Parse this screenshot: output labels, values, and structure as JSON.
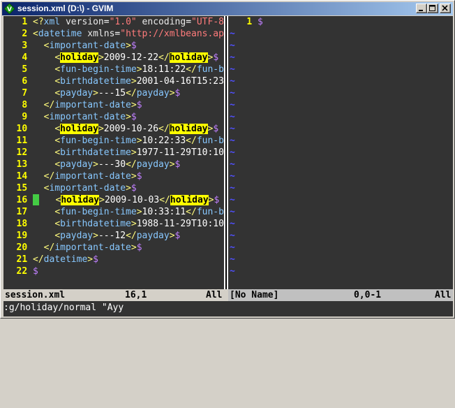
{
  "window": {
    "title": "session.xml (D:\\) - GVIM"
  },
  "left_pane": {
    "lines": [
      {
        "n": "1",
        "segs": [
          [
            "lt",
            "<?"
          ],
          [
            "tag",
            "xml"
          ],
          [
            "attr",
            " version"
          ],
          [
            "code",
            "="
          ],
          [
            "str",
            "\"1.0\""
          ],
          [
            "attr",
            " encoding"
          ],
          [
            "code",
            "="
          ],
          [
            "str",
            "\"UTF-8"
          ]
        ]
      },
      {
        "n": "2",
        "segs": [
          [
            "lt",
            "<"
          ],
          [
            "tag",
            "datetime"
          ],
          [
            "attr",
            " xmlns"
          ],
          [
            "code",
            "="
          ],
          [
            "str",
            "\"http://xmlbeans.ap"
          ]
        ]
      },
      {
        "n": "3",
        "segs": [
          [
            "code",
            "  "
          ],
          [
            "lt",
            "<"
          ],
          [
            "tag",
            "important-date"
          ],
          [
            "lt",
            ">"
          ],
          [
            "eol",
            "$"
          ]
        ]
      },
      {
        "n": "4",
        "segs": [
          [
            "code",
            "    "
          ],
          [
            "lt",
            "<"
          ],
          [
            "hl",
            "holiday"
          ],
          [
            "lt",
            ">"
          ],
          [
            "code",
            "2009-12-22"
          ],
          [
            "lt",
            "</"
          ],
          [
            "hl",
            "holiday"
          ],
          [
            "lt",
            ">"
          ],
          [
            "eol",
            "$"
          ]
        ]
      },
      {
        "n": "5",
        "segs": [
          [
            "code",
            "    "
          ],
          [
            "lt",
            "<"
          ],
          [
            "tag",
            "fun-begin-time"
          ],
          [
            "lt",
            ">"
          ],
          [
            "code",
            "18:11:22"
          ],
          [
            "lt",
            "</"
          ],
          [
            "tag",
            "fun-b"
          ]
        ]
      },
      {
        "n": "6",
        "segs": [
          [
            "code",
            "    "
          ],
          [
            "lt",
            "<"
          ],
          [
            "tag",
            "birthdatetime"
          ],
          [
            "lt",
            ">"
          ],
          [
            "code",
            "2001-04-16T15:23"
          ]
        ]
      },
      {
        "n": "7",
        "segs": [
          [
            "code",
            "    "
          ],
          [
            "lt",
            "<"
          ],
          [
            "tag",
            "payday"
          ],
          [
            "lt",
            ">"
          ],
          [
            "code",
            "---15"
          ],
          [
            "lt",
            "</"
          ],
          [
            "tag",
            "payday"
          ],
          [
            "lt",
            ">"
          ],
          [
            "eol",
            "$"
          ]
        ]
      },
      {
        "n": "8",
        "segs": [
          [
            "code",
            "  "
          ],
          [
            "lt",
            "</"
          ],
          [
            "tag",
            "important-date"
          ],
          [
            "lt",
            ">"
          ],
          [
            "eol",
            "$"
          ]
        ]
      },
      {
        "n": "9",
        "segs": [
          [
            "code",
            "  "
          ],
          [
            "lt",
            "<"
          ],
          [
            "tag",
            "important-date"
          ],
          [
            "lt",
            ">"
          ],
          [
            "eol",
            "$"
          ]
        ]
      },
      {
        "n": "10",
        "segs": [
          [
            "code",
            "    "
          ],
          [
            "lt",
            "<"
          ],
          [
            "hl",
            "holiday"
          ],
          [
            "lt",
            ">"
          ],
          [
            "code",
            "2009-10-26"
          ],
          [
            "lt",
            "</"
          ],
          [
            "hl",
            "holiday"
          ],
          [
            "lt",
            ">"
          ],
          [
            "eol",
            "$"
          ]
        ]
      },
      {
        "n": "11",
        "segs": [
          [
            "code",
            "    "
          ],
          [
            "lt",
            "<"
          ],
          [
            "tag",
            "fun-begin-time"
          ],
          [
            "lt",
            ">"
          ],
          [
            "code",
            "10:22:33"
          ],
          [
            "lt",
            "</"
          ],
          [
            "tag",
            "fun-b"
          ]
        ]
      },
      {
        "n": "12",
        "segs": [
          [
            "code",
            "    "
          ],
          [
            "lt",
            "<"
          ],
          [
            "tag",
            "birthdatetime"
          ],
          [
            "lt",
            ">"
          ],
          [
            "code",
            "1977-11-29T10:10"
          ]
        ]
      },
      {
        "n": "13",
        "segs": [
          [
            "code",
            "    "
          ],
          [
            "lt",
            "<"
          ],
          [
            "tag",
            "payday"
          ],
          [
            "lt",
            ">"
          ],
          [
            "code",
            "---30"
          ],
          [
            "lt",
            "</"
          ],
          [
            "tag",
            "payday"
          ],
          [
            "lt",
            ">"
          ],
          [
            "eol",
            "$"
          ]
        ]
      },
      {
        "n": "14",
        "segs": [
          [
            "code",
            "  "
          ],
          [
            "lt",
            "</"
          ],
          [
            "tag",
            "important-date"
          ],
          [
            "lt",
            ">"
          ],
          [
            "eol",
            "$"
          ]
        ]
      },
      {
        "n": "15",
        "segs": [
          [
            "code",
            "  "
          ],
          [
            "lt",
            "<"
          ],
          [
            "tag",
            "important-date"
          ],
          [
            "lt",
            ">"
          ],
          [
            "eol",
            "$"
          ]
        ]
      },
      {
        "n": "16",
        "segs": [
          [
            "code",
            "    "
          ],
          [
            "lt",
            "<"
          ],
          [
            "hl",
            "holiday"
          ],
          [
            "lt",
            ">"
          ],
          [
            "code",
            "2009-10-03"
          ],
          [
            "lt",
            "</"
          ],
          [
            "hl",
            "holiday"
          ],
          [
            "lt",
            ">"
          ],
          [
            "eol",
            "$"
          ]
        ]
      },
      {
        "n": "17",
        "segs": [
          [
            "code",
            "    "
          ],
          [
            "lt",
            "<"
          ],
          [
            "tag",
            "fun-begin-time"
          ],
          [
            "lt",
            ">"
          ],
          [
            "code",
            "10:33:11"
          ],
          [
            "lt",
            "</"
          ],
          [
            "tag",
            "fun-b"
          ]
        ]
      },
      {
        "n": "18",
        "segs": [
          [
            "code",
            "    "
          ],
          [
            "lt",
            "<"
          ],
          [
            "tag",
            "birthdatetime"
          ],
          [
            "lt",
            ">"
          ],
          [
            "code",
            "1988-11-29T10:10"
          ]
        ]
      },
      {
        "n": "19",
        "segs": [
          [
            "code",
            "    "
          ],
          [
            "lt",
            "<"
          ],
          [
            "tag",
            "payday"
          ],
          [
            "lt",
            ">"
          ],
          [
            "code",
            "---12"
          ],
          [
            "lt",
            "</"
          ],
          [
            "tag",
            "payday"
          ],
          [
            "lt",
            ">"
          ],
          [
            "eol",
            "$"
          ]
        ]
      },
      {
        "n": "20",
        "segs": [
          [
            "code",
            "  "
          ],
          [
            "lt",
            "</"
          ],
          [
            "tag",
            "important-date"
          ],
          [
            "lt",
            ">"
          ],
          [
            "eol",
            "$"
          ]
        ]
      },
      {
        "n": "21",
        "segs": [
          [
            "lt",
            "</"
          ],
          [
            "tag",
            "datetime"
          ],
          [
            "lt",
            ">"
          ],
          [
            "eol",
            "$"
          ]
        ]
      },
      {
        "n": "22",
        "segs": [
          [
            "eol",
            "$"
          ]
        ]
      }
    ],
    "cursor_line": "16"
  },
  "right_pane": {
    "lines": [
      {
        "n": "1",
        "segs": [
          [
            "eol",
            "$"
          ]
        ]
      }
    ],
    "tilde_count": 21,
    "tilde_char": "~"
  },
  "status": {
    "left_file": "session.xml",
    "left_pos": "16,1",
    "left_pct": "All",
    "right_file": "[No Name]",
    "right_pos": "0,0-1",
    "right_pct": "All"
  },
  "command_line": ":g/holiday/normal \"Ayy"
}
